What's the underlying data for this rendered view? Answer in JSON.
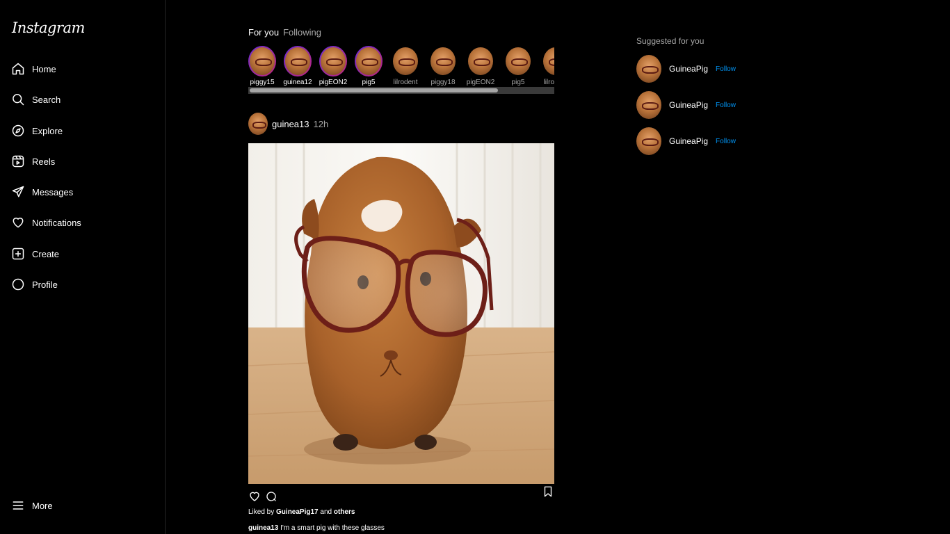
{
  "brand": {
    "logo_text": "Instagram"
  },
  "sidebar": {
    "items": [
      {
        "label": "Home",
        "icon": "home-icon"
      },
      {
        "label": "Search",
        "icon": "search-icon"
      },
      {
        "label": "Explore",
        "icon": "compass-icon"
      },
      {
        "label": "Reels",
        "icon": "reels-icon"
      },
      {
        "label": "Messages",
        "icon": "paper-plane-icon"
      },
      {
        "label": "Notifications",
        "icon": "heart-icon"
      },
      {
        "label": "Create",
        "icon": "plus-square-icon"
      },
      {
        "label": "Profile",
        "icon": "profile-circle-icon"
      }
    ],
    "more_label": "More"
  },
  "feed": {
    "tabs": {
      "for_you": "For you",
      "following": "Following"
    },
    "stories": [
      {
        "username": "piggy15",
        "unseen": true
      },
      {
        "username": "guinea12",
        "unseen": true
      },
      {
        "username": "pigEON2",
        "unseen": true
      },
      {
        "username": "pig5",
        "unseen": true
      },
      {
        "username": "lilrodent",
        "unseen": false
      },
      {
        "username": "piggy18",
        "unseen": false
      },
      {
        "username": "pigEON2",
        "unseen": false
      },
      {
        "username": "pig5",
        "unseen": false
      },
      {
        "username": "lilrodent",
        "unseen": false
      }
    ],
    "post": {
      "username": "guinea13",
      "time": "12h",
      "liked_by_prefix": "Liked by",
      "liked_by_user": "GuineaPig17",
      "liked_by_and": "and",
      "liked_by_others": "others",
      "caption_user": "guinea13",
      "caption_text": "I'm a smart pig with these glasses"
    }
  },
  "suggestions": {
    "title": "Suggested for you",
    "items": [
      {
        "name": "GuineaPig",
        "action": "Follow"
      },
      {
        "name": "GuineaPig",
        "action": "Follow"
      },
      {
        "name": "GuineaPig",
        "action": "Follow"
      }
    ]
  },
  "colors": {
    "background": "#000000",
    "accent": "#0095f6",
    "muted": "#a8a8a8",
    "story_ring": "#c0267b"
  }
}
